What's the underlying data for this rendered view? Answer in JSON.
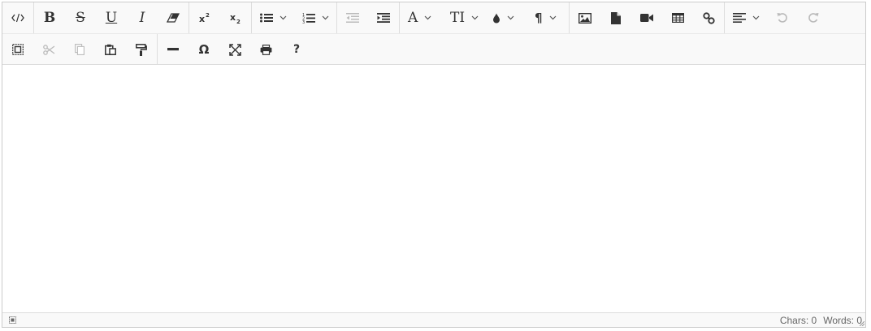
{
  "toolbar": {
    "row1": [
      {
        "name": "source-icon",
        "dropdown": false
      },
      {
        "name": "bold-icon",
        "dropdown": false,
        "glyph": "B"
      },
      {
        "name": "strikethrough-icon",
        "dropdown": false,
        "glyph": "S"
      },
      {
        "name": "underline-icon",
        "dropdown": false,
        "glyph": "U"
      },
      {
        "name": "italic-icon",
        "dropdown": false,
        "glyph": "I"
      },
      {
        "name": "eraser-icon",
        "dropdown": false
      },
      {
        "name": "superscript-icon",
        "dropdown": false
      },
      {
        "name": "subscript-icon",
        "dropdown": false
      },
      {
        "name": "unordered-list-icon",
        "dropdown": true
      },
      {
        "name": "ordered-list-icon",
        "dropdown": true
      },
      {
        "name": "outdent-icon",
        "dropdown": false,
        "disabled": true
      },
      {
        "name": "indent-icon",
        "dropdown": false
      },
      {
        "name": "font-icon",
        "dropdown": true,
        "glyph": "A"
      },
      {
        "name": "font-size-icon",
        "dropdown": true,
        "glyph": "TI"
      },
      {
        "name": "brush-color-icon",
        "dropdown": true
      },
      {
        "name": "paragraph-icon",
        "dropdown": true,
        "glyph": "¶"
      },
      {
        "name": "image-icon",
        "dropdown": false
      },
      {
        "name": "file-icon",
        "dropdown": false
      },
      {
        "name": "video-icon",
        "dropdown": false
      },
      {
        "name": "table-icon",
        "dropdown": false
      },
      {
        "name": "link-icon",
        "dropdown": false
      },
      {
        "name": "align-left-icon",
        "dropdown": true
      },
      {
        "name": "undo-icon",
        "dropdown": false,
        "disabled": true
      },
      {
        "name": "redo-icon",
        "dropdown": false,
        "disabled": true
      }
    ],
    "row2": [
      {
        "name": "select-all-icon",
        "disabled": false
      },
      {
        "name": "cut-icon",
        "disabled": true
      },
      {
        "name": "copy-icon",
        "disabled": true
      },
      {
        "name": "paste-icon",
        "disabled": false
      },
      {
        "name": "format-painter-icon",
        "disabled": false
      },
      {
        "name": "horizontal-rule-icon",
        "disabled": false
      },
      {
        "name": "omega-icon",
        "disabled": false,
        "glyph": "Ω"
      },
      {
        "name": "fullsize-icon",
        "disabled": false
      },
      {
        "name": "print-icon",
        "disabled": false
      },
      {
        "name": "about-icon",
        "disabled": false,
        "glyph": "?"
      }
    ]
  },
  "editor": {
    "content": ""
  },
  "statusbar": {
    "chars_label": "Chars: 0",
    "words_label": "Words: 0"
  },
  "colors": {
    "icon": "#333333",
    "icon_disabled": "#bbbbbb",
    "toolbar_bg": "#f9f9f9",
    "border": "#cccccc"
  }
}
